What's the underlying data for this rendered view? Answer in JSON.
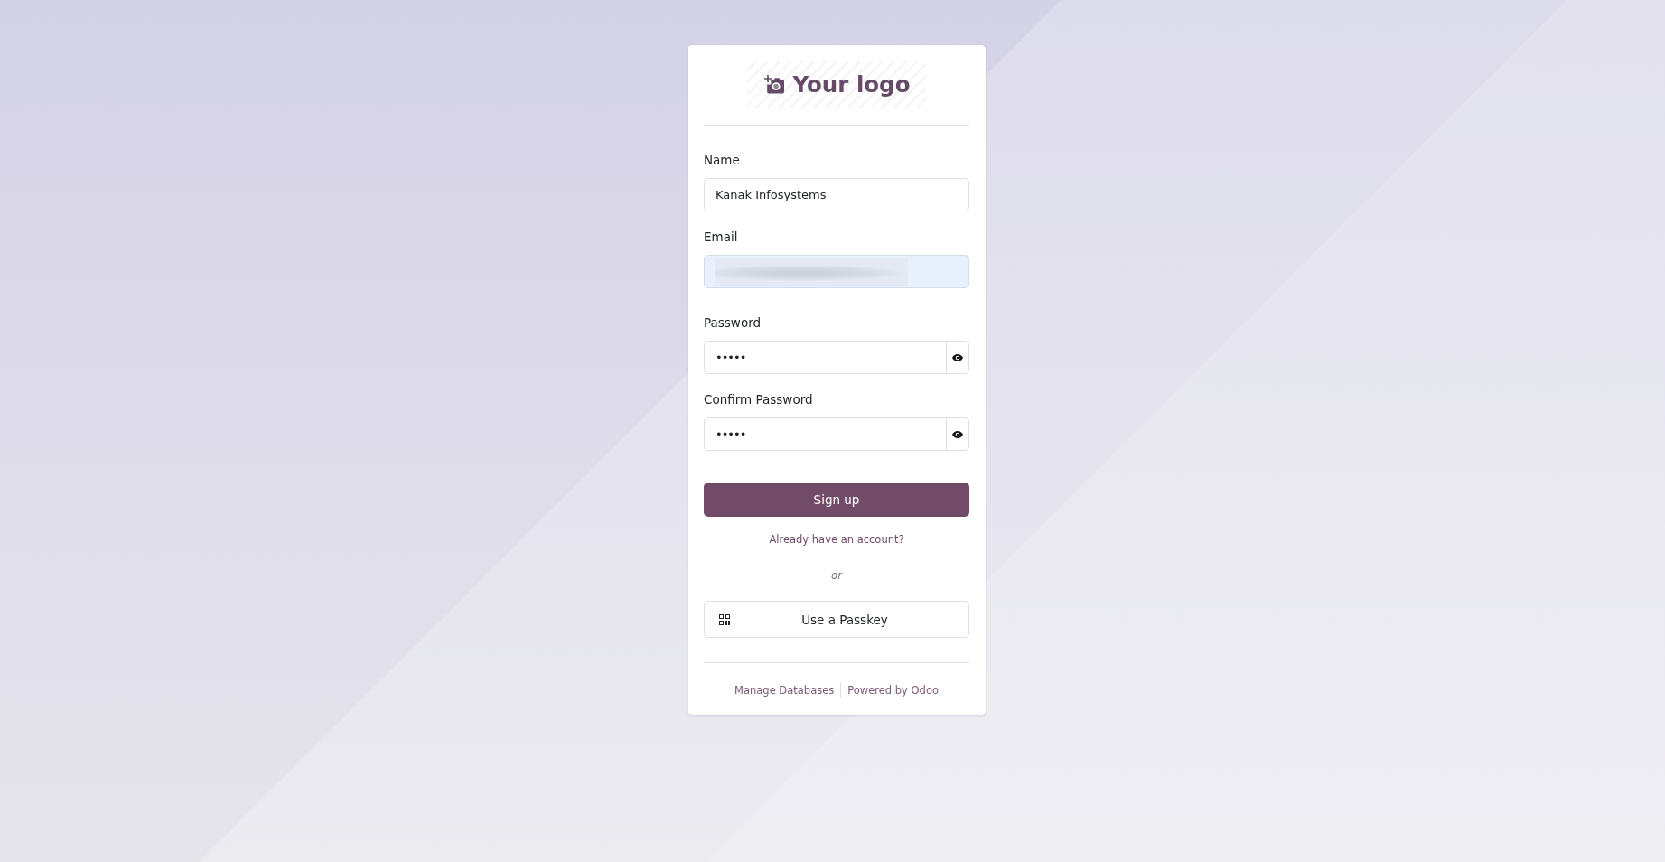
{
  "logo": {
    "text": "Your logo"
  },
  "fields": [
    {
      "kind": "text",
      "label": "Name",
      "value": "Kanak Infosystems",
      "autofilled": false,
      "redacted": false
    },
    {
      "kind": "email",
      "label": "Email",
      "autofilled": true,
      "redacted": true
    },
    {
      "kind": "password",
      "label": "Password",
      "value": "•••••",
      "autofilled": false,
      "redacted": false
    },
    {
      "kind": "password",
      "label": "Confirm Password",
      "value": "•••••",
      "autofilled": false,
      "redacted": false
    }
  ],
  "submit_button": {
    "label": "Sign up"
  },
  "login_link": {
    "label": "Already have an account?"
  },
  "separator": {
    "text": "- or -"
  },
  "passkey_button": {
    "label": "Use a Passkey"
  },
  "footer_links": [
    {
      "label": "Manage Databases"
    },
    {
      "label": "Powered by Odoo"
    }
  ]
}
